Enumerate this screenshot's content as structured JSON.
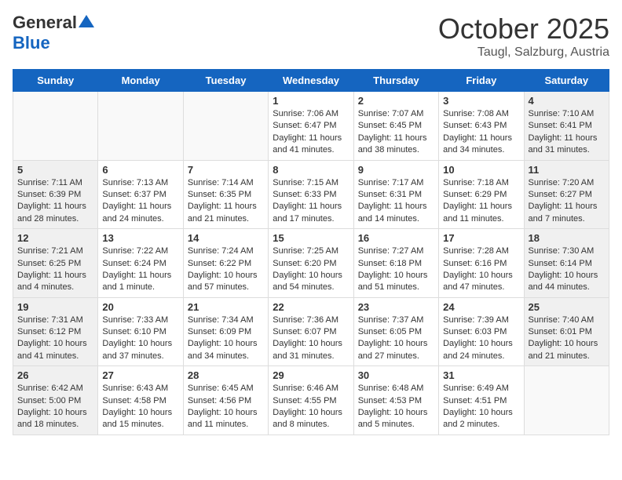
{
  "header": {
    "logo_general": "General",
    "logo_blue": "Blue",
    "title": "October 2025",
    "location": "Taugl, Salzburg, Austria"
  },
  "weekdays": [
    "Sunday",
    "Monday",
    "Tuesday",
    "Wednesday",
    "Thursday",
    "Friday",
    "Saturday"
  ],
  "weeks": [
    [
      {
        "day": "",
        "info": ""
      },
      {
        "day": "",
        "info": ""
      },
      {
        "day": "",
        "info": ""
      },
      {
        "day": "1",
        "info": "Sunrise: 7:06 AM\nSunset: 6:47 PM\nDaylight: 11 hours and 41 minutes."
      },
      {
        "day": "2",
        "info": "Sunrise: 7:07 AM\nSunset: 6:45 PM\nDaylight: 11 hours and 38 minutes."
      },
      {
        "day": "3",
        "info": "Sunrise: 7:08 AM\nSunset: 6:43 PM\nDaylight: 11 hours and 34 minutes."
      },
      {
        "day": "4",
        "info": "Sunrise: 7:10 AM\nSunset: 6:41 PM\nDaylight: 11 hours and 31 minutes."
      }
    ],
    [
      {
        "day": "5",
        "info": "Sunrise: 7:11 AM\nSunset: 6:39 PM\nDaylight: 11 hours and 28 minutes."
      },
      {
        "day": "6",
        "info": "Sunrise: 7:13 AM\nSunset: 6:37 PM\nDaylight: 11 hours and 24 minutes."
      },
      {
        "day": "7",
        "info": "Sunrise: 7:14 AM\nSunset: 6:35 PM\nDaylight: 11 hours and 21 minutes."
      },
      {
        "day": "8",
        "info": "Sunrise: 7:15 AM\nSunset: 6:33 PM\nDaylight: 11 hours and 17 minutes."
      },
      {
        "day": "9",
        "info": "Sunrise: 7:17 AM\nSunset: 6:31 PM\nDaylight: 11 hours and 14 minutes."
      },
      {
        "day": "10",
        "info": "Sunrise: 7:18 AM\nSunset: 6:29 PM\nDaylight: 11 hours and 11 minutes."
      },
      {
        "day": "11",
        "info": "Sunrise: 7:20 AM\nSunset: 6:27 PM\nDaylight: 11 hours and 7 minutes."
      }
    ],
    [
      {
        "day": "12",
        "info": "Sunrise: 7:21 AM\nSunset: 6:25 PM\nDaylight: 11 hours and 4 minutes."
      },
      {
        "day": "13",
        "info": "Sunrise: 7:22 AM\nSunset: 6:24 PM\nDaylight: 11 hours and 1 minute."
      },
      {
        "day": "14",
        "info": "Sunrise: 7:24 AM\nSunset: 6:22 PM\nDaylight: 10 hours and 57 minutes."
      },
      {
        "day": "15",
        "info": "Sunrise: 7:25 AM\nSunset: 6:20 PM\nDaylight: 10 hours and 54 minutes."
      },
      {
        "day": "16",
        "info": "Sunrise: 7:27 AM\nSunset: 6:18 PM\nDaylight: 10 hours and 51 minutes."
      },
      {
        "day": "17",
        "info": "Sunrise: 7:28 AM\nSunset: 6:16 PM\nDaylight: 10 hours and 47 minutes."
      },
      {
        "day": "18",
        "info": "Sunrise: 7:30 AM\nSunset: 6:14 PM\nDaylight: 10 hours and 44 minutes."
      }
    ],
    [
      {
        "day": "19",
        "info": "Sunrise: 7:31 AM\nSunset: 6:12 PM\nDaylight: 10 hours and 41 minutes."
      },
      {
        "day": "20",
        "info": "Sunrise: 7:33 AM\nSunset: 6:10 PM\nDaylight: 10 hours and 37 minutes."
      },
      {
        "day": "21",
        "info": "Sunrise: 7:34 AM\nSunset: 6:09 PM\nDaylight: 10 hours and 34 minutes."
      },
      {
        "day": "22",
        "info": "Sunrise: 7:36 AM\nSunset: 6:07 PM\nDaylight: 10 hours and 31 minutes."
      },
      {
        "day": "23",
        "info": "Sunrise: 7:37 AM\nSunset: 6:05 PM\nDaylight: 10 hours and 27 minutes."
      },
      {
        "day": "24",
        "info": "Sunrise: 7:39 AM\nSunset: 6:03 PM\nDaylight: 10 hours and 24 minutes."
      },
      {
        "day": "25",
        "info": "Sunrise: 7:40 AM\nSunset: 6:01 PM\nDaylight: 10 hours and 21 minutes."
      }
    ],
    [
      {
        "day": "26",
        "info": "Sunrise: 6:42 AM\nSunset: 5:00 PM\nDaylight: 10 hours and 18 minutes."
      },
      {
        "day": "27",
        "info": "Sunrise: 6:43 AM\nSunset: 4:58 PM\nDaylight: 10 hours and 15 minutes."
      },
      {
        "day": "28",
        "info": "Sunrise: 6:45 AM\nSunset: 4:56 PM\nDaylight: 10 hours and 11 minutes."
      },
      {
        "day": "29",
        "info": "Sunrise: 6:46 AM\nSunset: 4:55 PM\nDaylight: 10 hours and 8 minutes."
      },
      {
        "day": "30",
        "info": "Sunrise: 6:48 AM\nSunset: 4:53 PM\nDaylight: 10 hours and 5 minutes."
      },
      {
        "day": "31",
        "info": "Sunrise: 6:49 AM\nSunset: 4:51 PM\nDaylight: 10 hours and 2 minutes."
      },
      {
        "day": "",
        "info": ""
      }
    ]
  ]
}
